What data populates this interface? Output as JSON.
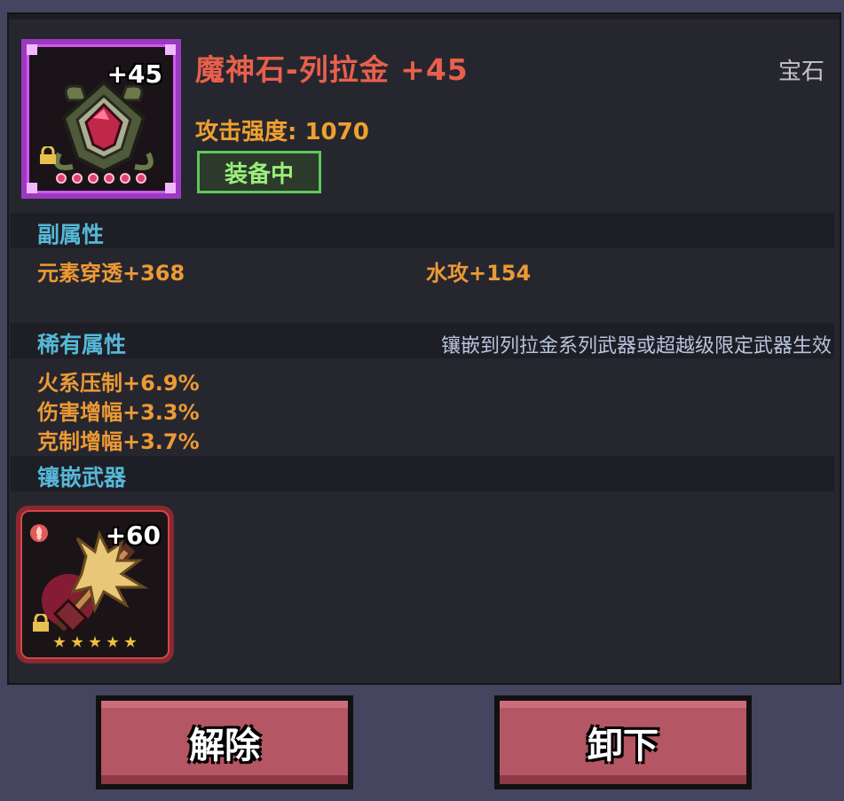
{
  "item": {
    "name": "魔神石-列拉金 +45",
    "type": "宝石",
    "icon_level": "+45",
    "attack_label": "攻击强度: 1070",
    "equipped_label": "装备中",
    "icon": "demon-gem-icon"
  },
  "sub_attributes": {
    "title": "副属性",
    "stats": [
      "元素穿透+368",
      "水攻+154"
    ]
  },
  "rare_attributes": {
    "title": "稀有属性",
    "note": "镶嵌到列拉金系列武器或超越级限定武器生效",
    "stats": [
      "火系压制+6.9%",
      "伤害增幅+3.3%",
      "克制增幅+3.7%"
    ]
  },
  "inlaid_weapon": {
    "title": "镶嵌武器",
    "level": "+60",
    "icon": "spiked-weapon-icon",
    "stars": 5
  },
  "buttons": {
    "release": "解除",
    "unequip": "卸下"
  },
  "colors": {
    "title": "#e8604c",
    "stat": "#ec9a35",
    "section": "#55b8d6",
    "equipped": "#9bee7a",
    "button": "#b45664"
  }
}
